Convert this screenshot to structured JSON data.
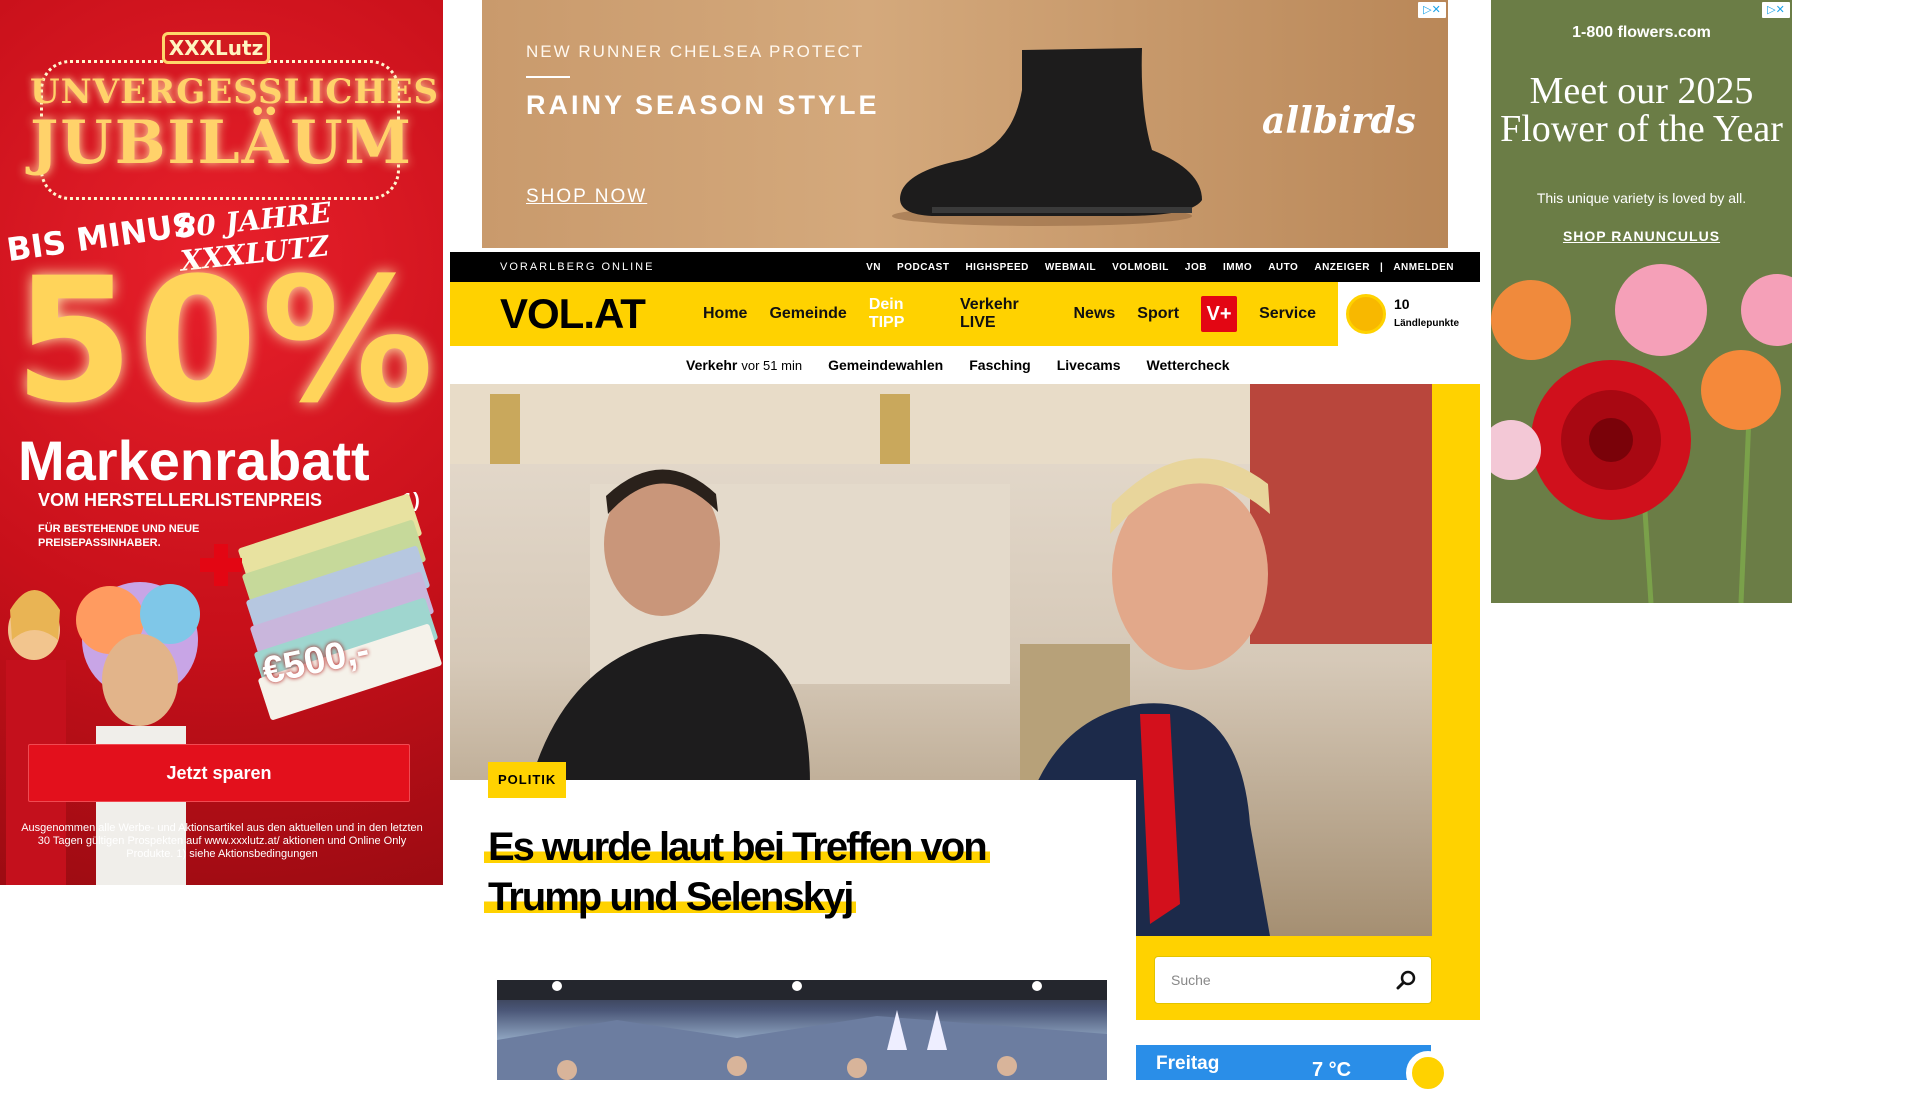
{
  "left_ad": {
    "brand": "XXXLutz",
    "headline_line1": "UNVERGESSLICHES",
    "headline_line2": "JUBILÄUM",
    "years": "80 JAHRE XXXLUTZ",
    "bis_minus": "BIS MINUS",
    "percent": "50%",
    "marken": "Markenrabatt",
    "vom": "VOM HERSTELLERLISTENPREIS",
    "footnote_mark": "1)",
    "fuer": "FÜR BESTEHENDE UND NEUE PREISEPASSINHABER.",
    "voucher_amount": "€500,-",
    "cta": "Jetzt sparen",
    "fine_print": "Ausgenommen alle Werbe- und Aktionsartikel aus den aktuellen und in den letzten 30 Tagen gültigen Prospekten auf www.xxxlutz.at/ aktionen und Online Only Produkte. 1) siehe Aktionsbedingungen",
    "colors": {
      "background": "#c8101a",
      "gold": "#ffd45a"
    }
  },
  "top_ad": {
    "eyebrow": "NEW RUNNER CHELSEA PROTECT",
    "headline": "RAINY SEASON STYLE",
    "cta": "SHOP NOW",
    "logo": "allbirds",
    "adchoices": "▷✕"
  },
  "right_ad": {
    "brand": "1-800 flowers.com",
    "headline": "Meet our 2025 Flower of the Year",
    "sub": "This unique variety is loved by all.",
    "cta": "SHOP RANUNCULUS",
    "adchoices": "▷✕"
  },
  "topbar": {
    "site": "VORARLBERG ONLINE",
    "links": [
      "VN",
      "PODCAST",
      "HIGHSPEED",
      "WEBMAIL",
      "VOLMOBIL",
      "JOB",
      "IMMO",
      "AUTO",
      "ANZEIGER"
    ],
    "separator": "|",
    "login": "ANMELDEN"
  },
  "mainnav": {
    "logo": "VOL.AT",
    "items": [
      "Home",
      "Gemeinde",
      "Dein TIPP",
      "Verkehr LIVE",
      "News",
      "Sport"
    ],
    "vplus": "V+",
    "service": "Service",
    "points_value": "10",
    "points_label": "Ländlepunkte"
  },
  "subnav": {
    "verkehr": "Verkehr",
    "verkehr_time": "vor 51 min",
    "items": [
      "Gemeindewahlen",
      "Fasching",
      "Livecams",
      "Wettercheck"
    ]
  },
  "article": {
    "kicker": "POLITIK",
    "title": "Es wurde laut bei Treffen von Trump und Selenskyj"
  },
  "search": {
    "placeholder": "Suche"
  },
  "weather": {
    "day": "Freitag",
    "temp": "7 °C"
  },
  "icons": {
    "search": "search-icon",
    "sun": "sun-icon"
  },
  "colors": {
    "brand_yellow": "#ffd200",
    "vplus_red": "#e30613",
    "weather_blue": "#2a8ee8"
  }
}
